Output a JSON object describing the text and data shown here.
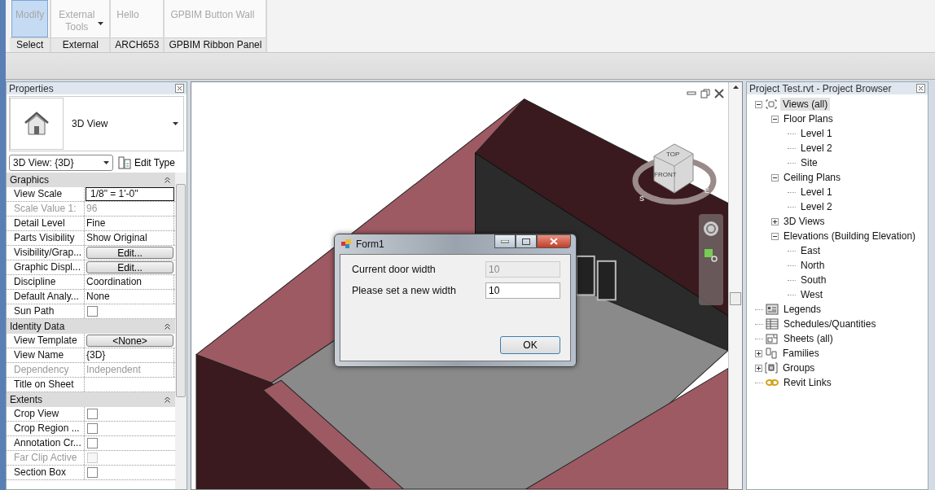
{
  "ribbon": {
    "panels": [
      {
        "label": "Select",
        "buttons": [
          {
            "label": "Modify",
            "selected": true,
            "dropdown": false
          }
        ]
      },
      {
        "label": "External",
        "buttons": [
          {
            "label": "External Tools",
            "selected": false,
            "dropdown": true
          }
        ]
      },
      {
        "label": "ARCH653",
        "buttons": [
          {
            "label": "Hello",
            "selected": false,
            "dropdown": false
          }
        ]
      },
      {
        "label": "GPBIM Ribbon Panel",
        "buttons": [
          {
            "label": "GPBIM Button Wall",
            "selected": false,
            "dropdown": false
          }
        ]
      }
    ]
  },
  "properties": {
    "title": "Properties",
    "type_name": "3D View",
    "instance": "3D View: {3D}",
    "edit_type": "Edit Type",
    "rows": [
      {
        "kind": "header",
        "label": "Graphics"
      },
      {
        "kind": "input",
        "label": "View Scale",
        "value": "1/8\" = 1'-0\"",
        "disabled": false
      },
      {
        "kind": "text",
        "label": "Scale Value    1:",
        "value": "96",
        "disabled": true
      },
      {
        "kind": "text",
        "label": "Detail Level",
        "value": "Fine",
        "disabled": false
      },
      {
        "kind": "text",
        "label": "Parts Visibility",
        "value": "Show Original",
        "disabled": false
      },
      {
        "kind": "button",
        "label": "Visibility/Grap...",
        "value": "Edit...",
        "disabled": false
      },
      {
        "kind": "button",
        "label": "Graphic Displ...",
        "value": "Edit...",
        "disabled": false
      },
      {
        "kind": "text",
        "label": "Discipline",
        "value": "Coordination",
        "disabled": false
      },
      {
        "kind": "text",
        "label": "Default Analy...",
        "value": "None",
        "disabled": false
      },
      {
        "kind": "checkbox",
        "label": "Sun Path",
        "checked": false,
        "disabled": false
      },
      {
        "kind": "header",
        "label": "Identity Data"
      },
      {
        "kind": "button",
        "label": "View Template",
        "value": "<None>",
        "disabled": false
      },
      {
        "kind": "text",
        "label": "View Name",
        "value": "{3D}",
        "disabled": false
      },
      {
        "kind": "text",
        "label": "Dependency",
        "value": "Independent",
        "disabled": true
      },
      {
        "kind": "text",
        "label": "Title on Sheet",
        "value": "",
        "disabled": false
      },
      {
        "kind": "header",
        "label": "Extents"
      },
      {
        "kind": "checkbox",
        "label": "Crop View",
        "checked": false,
        "disabled": false
      },
      {
        "kind": "checkbox",
        "label": "Crop Region ...",
        "checked": false,
        "disabled": false
      },
      {
        "kind": "checkbox",
        "label": "Annotation Cr...",
        "checked": false,
        "disabled": false
      },
      {
        "kind": "checkbox",
        "label": "Far Clip Active",
        "checked": false,
        "disabled": true
      },
      {
        "kind": "checkbox",
        "label": "Section Box",
        "checked": false,
        "disabled": false
      }
    ]
  },
  "viewport": {
    "viewcube": {
      "top": "TOP",
      "front": "FRONT",
      "south": "S",
      "east": "E"
    }
  },
  "dialog": {
    "title": "Form1",
    "fields": [
      {
        "label": "Current door width",
        "value": "10",
        "disabled": true
      },
      {
        "label": "Please set a new width",
        "value": "10",
        "disabled": false
      }
    ],
    "ok": "OK"
  },
  "browser": {
    "title": "Project Test.rvt - Project Browser",
    "tree": [
      {
        "label": "Views (all)",
        "kind": "views",
        "selected": true,
        "expanded": true,
        "children": [
          {
            "label": "Floor Plans",
            "selected": false,
            "expanded": true,
            "children": [
              {
                "label": "Level 1",
                "selected": false
              },
              {
                "label": "Level 2",
                "selected": false
              },
              {
                "label": "Site",
                "selected": false
              }
            ]
          },
          {
            "label": "Ceiling Plans",
            "selected": false,
            "expanded": true,
            "children": [
              {
                "label": "Level 1",
                "selected": false
              },
              {
                "label": "Level 2",
                "selected": false
              }
            ]
          },
          {
            "label": "3D Views",
            "selected": false,
            "expanded": false
          },
          {
            "label": "Elevations (Building Elevation)",
            "selected": false,
            "expanded": true,
            "children": [
              {
                "label": "East",
                "selected": false
              },
              {
                "label": "North",
                "selected": false
              },
              {
                "label": "South",
                "selected": false
              },
              {
                "label": "West",
                "selected": false
              }
            ]
          }
        ]
      },
      {
        "label": "Legends",
        "kind": "legends",
        "selected": false
      },
      {
        "label": "Schedules/Quantities",
        "kind": "schedules",
        "selected": false
      },
      {
        "label": "Sheets (all)",
        "kind": "sheets",
        "selected": false
      },
      {
        "label": "Families",
        "kind": "families",
        "selected": false,
        "expanded": false
      },
      {
        "label": "Groups",
        "kind": "groups",
        "selected": false,
        "expanded": false
      },
      {
        "label": "Revit Links",
        "kind": "links",
        "selected": false
      }
    ]
  }
}
